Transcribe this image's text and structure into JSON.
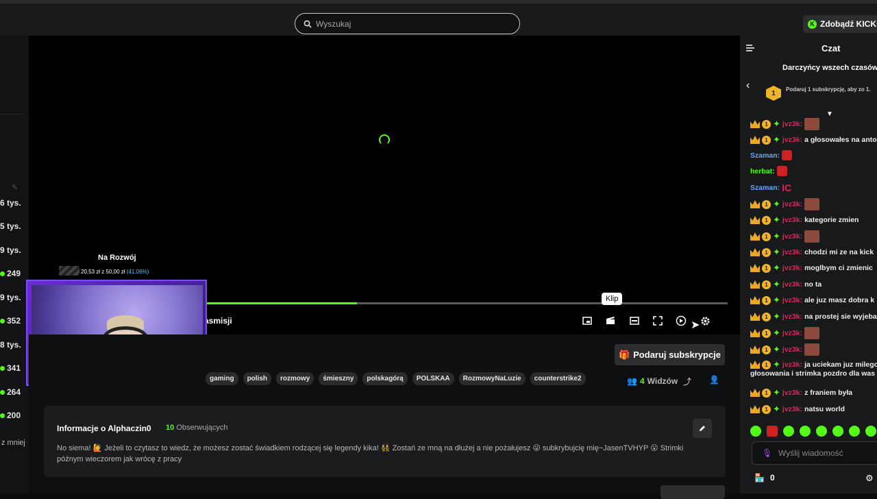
{
  "header": {
    "search_placeholder": "Wyszukaj",
    "kicks_label": "Zdobądź KICKs"
  },
  "sidebar": {
    "stats": [
      "6 tys.",
      "5 tys.",
      "9 tys.",
      "249",
      "9 tys.",
      "352",
      "8 tys.",
      "341",
      "264",
      "200"
    ],
    "more_label": "z mniej"
  },
  "player": {
    "progress": 0.29,
    "title_fragment": "asmisji",
    "tooltip": "Klip",
    "controls": [
      "mini-player-icon",
      "clip-icon",
      "theater-icon",
      "fullscreen-icon",
      "speed-icon",
      "settings-icon"
    ]
  },
  "goal": {
    "label": "Na Rozwój",
    "current": "20,53 zł",
    "separator": "z",
    "target": "50,00 zł",
    "percent": "(41.06%)"
  },
  "stream": {
    "tags": [
      "gaming",
      "polish",
      "rozmowy",
      "śmieszny",
      "polskagórą",
      "POLSKAA",
      "RozmowyNaLuzie",
      "counterstrike2"
    ],
    "gift_sub_label": "Podaruj subskrypcje",
    "viewers_count": "4",
    "viewers_label": "Widzów"
  },
  "about": {
    "title": "Informacje o Alphaczin0",
    "followers_count": "10",
    "followers_label": "Obserwujących",
    "text": "No siema! 🙋 Jeżeli to czytasz to wiedz, że możesz zostać świadkiem rodzącej się legendy kika! 👯 Zostań ze mną na dłużej a nie pożałujesz 😜 subkrybujcię mię~JasenTVHYP 😮 Strimki późnym wieczorem jak wrócę z pracy"
  },
  "chat": {
    "title": "Czat",
    "donors_label": "Darczyńcy wszech czasów",
    "donate_hint": "Podaruj 1 subskrypcję, aby zo 1.",
    "rank": "1",
    "messages": [
      {
        "user": "jvz3k",
        "text": "",
        "emote": true,
        "badges": true,
        "color": "red"
      },
      {
        "user": "jvz3k",
        "text": "a głosowałes na anto",
        "badges": true,
        "color": "red"
      },
      {
        "user": "Szaman",
        "text": "",
        "emote_red": true,
        "color": "blue"
      },
      {
        "user": "herbat",
        "text": "",
        "emote_red": true,
        "color": "green"
      },
      {
        "user": "Szaman",
        "text": "",
        "emote_ic": true,
        "color": "blue"
      },
      {
        "user": "jvz3k",
        "text": "",
        "emote": true,
        "badges": true,
        "color": "red"
      },
      {
        "user": "jvz3k",
        "text": "kategorie zmien",
        "badges": true,
        "color": "red"
      },
      {
        "user": "jvz3k",
        "text": "",
        "emote": true,
        "badges": true,
        "color": "red"
      },
      {
        "user": "jvz3k",
        "text": "chodzi mi ze na kick",
        "badges": true,
        "color": "red"
      },
      {
        "user": "jvz3k",
        "text": "moglbym ci zmienic",
        "badges": true,
        "color": "red"
      },
      {
        "user": "jvz3k",
        "text": "no ta",
        "badges": true,
        "color": "red"
      },
      {
        "user": "jvz3k",
        "text": "ale juz masz dobra k",
        "badges": true,
        "color": "red"
      },
      {
        "user": "jvz3k",
        "text": "na prostej sie wyjeba",
        "badges": true,
        "color": "red"
      },
      {
        "user": "jvz3k",
        "text": "",
        "emote": true,
        "badges": true,
        "color": "red"
      },
      {
        "user": "jvz3k",
        "text": "",
        "emote": true,
        "badges": true,
        "color": "red"
      },
      {
        "user": "jvz3k",
        "text": "ja uciekam juz milego",
        "badges": true,
        "color": "red",
        "wrap": "głosowania i strimka pozdro dla was"
      },
      {
        "user": "jvz3k",
        "text": "z franiem była",
        "badges": true,
        "color": "red"
      },
      {
        "user": "jvz3k",
        "text": "natsu world",
        "badges": true,
        "color": "red"
      }
    ],
    "input_placeholder": "Wyślij wiadomość",
    "store_count": "0"
  }
}
